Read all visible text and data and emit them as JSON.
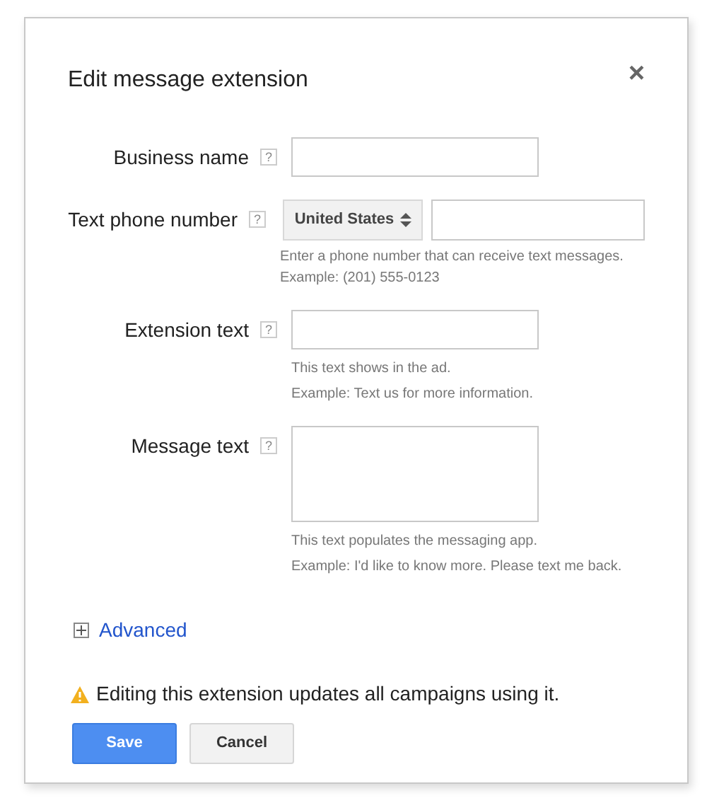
{
  "dialog": {
    "title": "Edit message extension",
    "close": "×"
  },
  "fields": [
    {
      "kind": "text",
      "label": "Business name",
      "help_icon": "?"
    },
    {
      "kind": "phone",
      "label": "Text phone number",
      "help_icon": "?",
      "country": "United States",
      "hints": [
        "Enter a phone number that can receive text messages.",
        "Example: (201) 555-0123"
      ]
    },
    {
      "kind": "text",
      "label": "Extension text",
      "help_icon": "?",
      "hints": [
        "This text shows in the ad.",
        "Example: Text us for more information."
      ]
    },
    {
      "kind": "textarea",
      "label": "Message text",
      "help_icon": "?",
      "hints": [
        "This text populates the messaging app.",
        "Example: I'd like to know more. Please text me back."
      ]
    }
  ],
  "advanced": {
    "label": "Advanced",
    "expanded": false
  },
  "warning": "Editing this extension updates all campaigns using it.",
  "buttons": [
    {
      "kind": "primary",
      "label": "Save"
    },
    {
      "kind": "secondary",
      "label": "Cancel"
    }
  ]
}
